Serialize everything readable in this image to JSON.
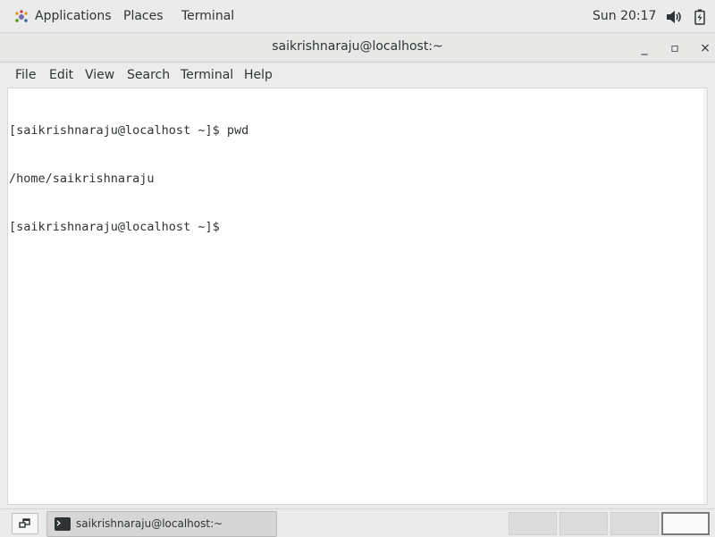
{
  "top_panel": {
    "applications": "Applications",
    "places": "Places",
    "terminal": "Terminal",
    "clock": "Sun 20:17",
    "icons": {
      "applications": "gnome-foot-icon",
      "volume": "volume-icon",
      "battery": "battery-icon"
    }
  },
  "window": {
    "title": "saikrishnaraju@localhost:~",
    "controls": {
      "minimize": "_",
      "maximize": "▫",
      "close": "×"
    }
  },
  "menubar": {
    "items": [
      "File",
      "Edit",
      "View",
      "Search",
      "Terminal",
      "Help"
    ]
  },
  "terminal": {
    "lines": [
      "[saikrishnaraju@localhost ~]$ pwd",
      "/home/saikrishnaraju",
      "[saikrishnaraju@localhost ~]$ "
    ]
  },
  "bottom_panel": {
    "task_label": "saikrishnaraju@localhost:~",
    "workspaces": 4,
    "active_workspace": 4,
    "icons": {
      "show_desktop": "window-restore-icon",
      "task": "terminal-icon"
    }
  },
  "colors": {
    "panel_bg": "#ebebeb",
    "terminal_bg": "#ffffff",
    "text": "#2e3436",
    "active_workspace_border": "#7c7c7c"
  }
}
